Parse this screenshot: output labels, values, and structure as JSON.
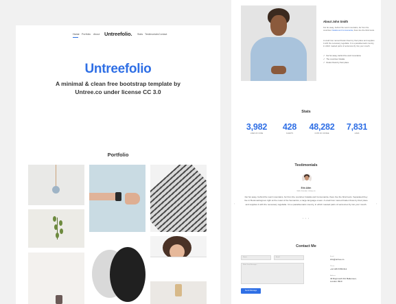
{
  "nav": {
    "links_left": [
      "Home",
      "Portfolio",
      "About"
    ],
    "brand": "Untreefolio.",
    "links_right": [
      "Stats",
      "Testimonials",
      "Contact"
    ]
  },
  "hero": {
    "title": "Untreefolio",
    "subtitle": "A minimal & clean free bootstrap template by Untree.co under license CC 3.0"
  },
  "portfolio": {
    "title": "Portfolio"
  },
  "about": {
    "title": "About John Smith",
    "p1_start": "Far far away, behind the word mountains, far from the countries ",
    "p1_link": "Vokalia and Consonantia",
    "p1_end": ", there live the blind texts.",
    "p2": "A small river named Duden flows by their place and supplies it with the necessary regelialia. It is a paradisematic country, in which roasted parts of sentences fly into your mouth.",
    "checks": [
      "Far far away, behind the word mountains",
      "The countries Vokalia",
      "Duden flows by their place"
    ]
  },
  "stats": {
    "title": "Stats",
    "items": [
      {
        "value": "3,982",
        "label": "LINES OF CODE"
      },
      {
        "value": "428",
        "label": "CLIENTS"
      },
      {
        "value": "48,282",
        "label": "CUPS OF COFFEE"
      },
      {
        "value": "7,831",
        "label": "LIKES"
      }
    ]
  },
  "testimonials": {
    "title": "Testimonials",
    "name": "Erin Allen",
    "role": "CEO, Founder, Untree.co",
    "quote": "Far far away, behind the word mountains, far from the countries Vokalia and Consonantia, there live the blind texts. Separated they live in Bookmarksgrove right at the coast of the Semantics, a large language ocean. A small river named Duden flows by their place and supplies it with the necessary regelialia. It is a paradisematic country, in which roasted parts of sentences fly into your mouth.",
    "prev": "‹",
    "next": "›",
    "dots": "• • •"
  },
  "contact": {
    "title": "Contact Me",
    "name_placeholder": "Name",
    "email_placeholder": "Email",
    "message_placeholder": "Write Your Message...",
    "send_label": "Send Message",
    "email_label": "Email",
    "email_value": "info@untree.co",
    "phone_label": "Phone",
    "phone_value": "+12 345 6789 012",
    "address_label": "Address",
    "address_value": "43 Raymouth Rd. Baltemoer, London 3910"
  }
}
